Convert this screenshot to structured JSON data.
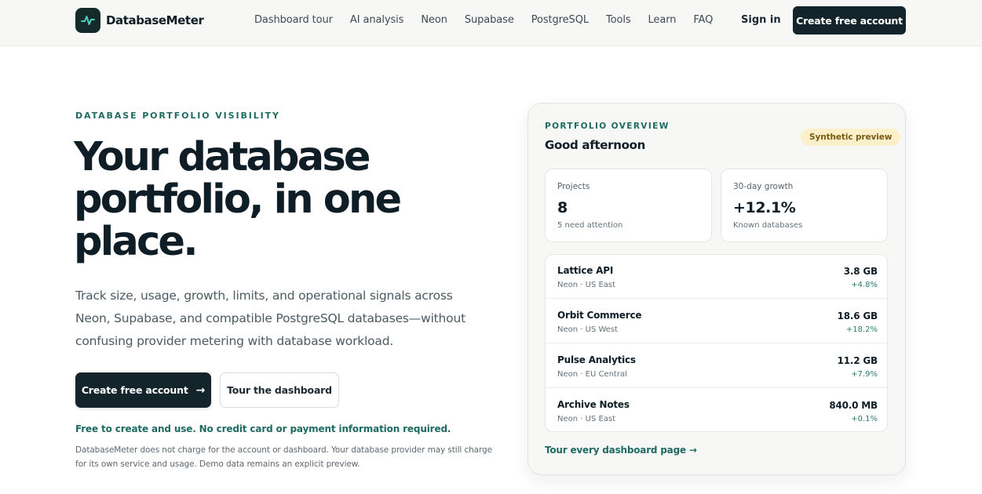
{
  "nav": {
    "brand": "DatabaseMeter",
    "links": [
      "Dashboard tour",
      "AI analysis",
      "Neon",
      "Supabase",
      "PostgreSQL",
      "Tools",
      "Learn",
      "FAQ"
    ],
    "sign_in": "Sign in",
    "cta": "Create free account"
  },
  "hero": {
    "eyebrow": "DATABASE PORTFOLIO VISIBILITY",
    "headline": "Your database portfolio, in one place.",
    "subtext": "Track size, usage, growth, limits, and operational signals across Neon, Supabase, and compatible PostgreSQL databases—without confusing provider metering with database workload.",
    "primary_button": "Create free account",
    "primary_arrow": "→",
    "secondary_button": "Tour the dashboard",
    "free_note": "Free to create and use. No credit card or payment information required.",
    "disclaimer": "DatabaseMeter does not charge for the account or dashboard. Your database provider may still charge for its own service and usage. Demo data remains an explicit preview."
  },
  "preview": {
    "eyebrow": "PORTFOLIO OVERVIEW",
    "greeting": "Good afternoon",
    "badge": "Synthetic preview",
    "stats": [
      {
        "label": "Projects",
        "value": "8",
        "note": "5 need attention"
      },
      {
        "label": "30-day growth",
        "value": "+12.1%",
        "note": "Known databases"
      }
    ],
    "databases": [
      {
        "name": "Lattice API",
        "meta": "Neon · US East",
        "size": "3.8 GB",
        "growth": "+4.8%"
      },
      {
        "name": "Orbit Commerce",
        "meta": "Neon · US West",
        "size": "18.6 GB",
        "growth": "+18.2%"
      },
      {
        "name": "Pulse Analytics",
        "meta": "Neon · EU Central",
        "size": "11.2 GB",
        "growth": "+7.9%"
      },
      {
        "name": "Archive Notes",
        "meta": "Neon · US East",
        "size": "840.0 MB",
        "growth": "+0.1%"
      }
    ],
    "tour_link": "Tour every dashboard page →"
  },
  "colors": {
    "brand_dark": "#13252b",
    "accent_teal": "#1f6b62",
    "badge_bg": "#fbf0c9"
  }
}
